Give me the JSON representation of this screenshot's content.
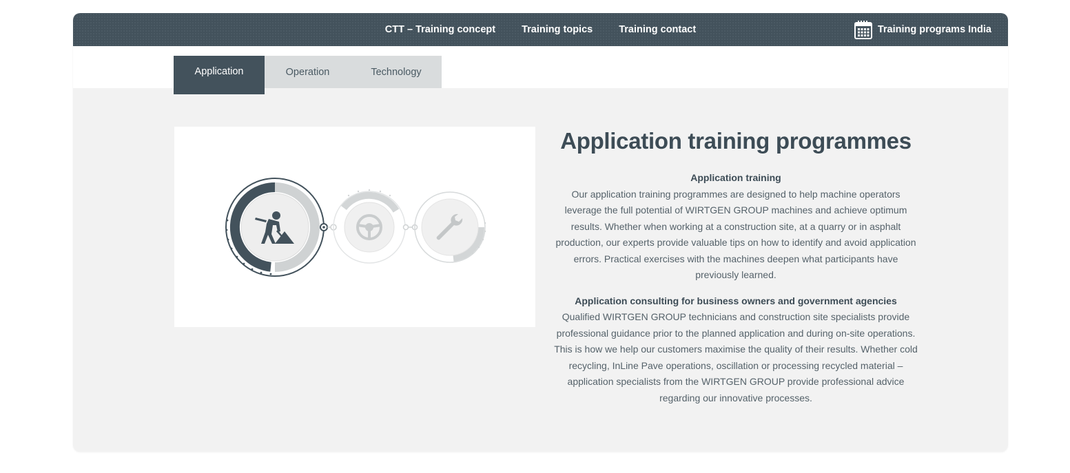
{
  "nav": {
    "links": [
      "CTT – Training concept",
      "Training topics",
      "Training contact"
    ],
    "right_label": "Training programs India",
    "right_icon": "calendar-icon"
  },
  "tabs": [
    {
      "label": "Application",
      "active": true
    },
    {
      "label": "Operation",
      "active": false
    },
    {
      "label": "Technology",
      "active": false
    }
  ],
  "graphic": {
    "icons": [
      "construction-worker-icon",
      "steering-wheel-icon",
      "wrench-icon"
    ]
  },
  "content": {
    "title": "Application training programmes",
    "section1_title": "Application training",
    "section1_body": "Our application training programmes are designed to help machine operators leverage the full potential of WIRTGEN GROUP machines and achieve optimum results. Whether when working at a construction site, at a quarry or in asphalt production, our experts provide valuable tips on how to identify and avoid application errors. Practical exercises with the machines deepen what participants have previously learned.",
    "section2_title": "Application consulting for business owners and government agencies",
    "section2_body": "Qualified WIRTGEN GROUP technicians and construction site specialists provide professional guidance prior to the planned application and during on-site operations. This is how we help our customers maximise the quality of their results. Whether cold recycling, InLine Pave operations, oscillation or processing recycled material – application specialists from the WIRTGEN GROUP provide professional advice regarding our innovative processes."
  },
  "colors": {
    "nav_bg": "#43525c",
    "tab_inactive": "#d9dcdd",
    "panel_bg": "#f2f2f2",
    "text": "#3d4c56"
  }
}
